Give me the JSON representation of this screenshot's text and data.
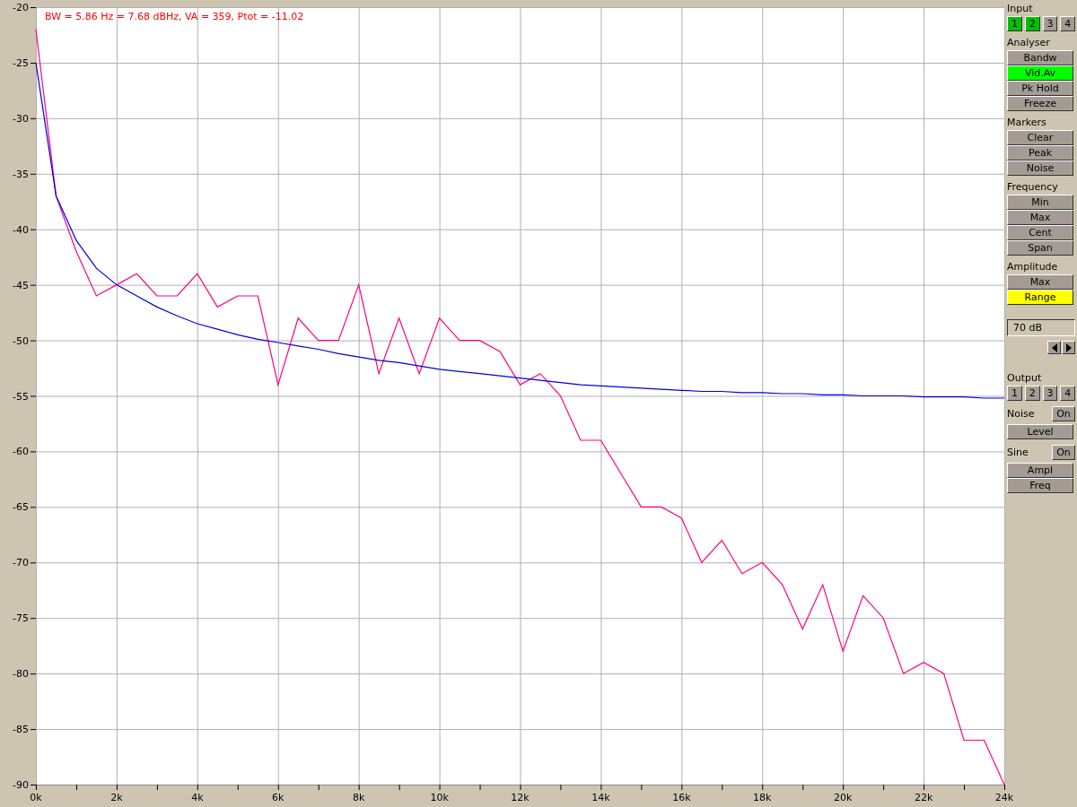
{
  "plot": {
    "readout": "BW = 5.86 Hz =  7.68 dBHz, VA = 359, Ptot = -11.02",
    "chart_data": {
      "type": "line",
      "grid": true,
      "xlim": [
        0,
        24000
      ],
      "ylim": [
        -90,
        -20
      ],
      "x": [
        0,
        500,
        1000,
        1500,
        2000,
        2500,
        3000,
        3500,
        4000,
        4500,
        5000,
        5500,
        6000,
        6500,
        7000,
        7500,
        8000,
        8500,
        9000,
        9500,
        10000,
        10500,
        11000,
        11500,
        12000,
        12500,
        13000,
        13500,
        14000,
        14500,
        15000,
        15500,
        16000,
        16500,
        17000,
        17500,
        18000,
        18500,
        19000,
        19500,
        20000,
        20500,
        21000,
        21500,
        22000,
        22500,
        23000,
        23500,
        24000
      ],
      "xticks": [
        {
          "value": 0,
          "label": "0k"
        },
        {
          "value": 2000,
          "label": "2k"
        },
        {
          "value": 4000,
          "label": "4k"
        },
        {
          "value": 6000,
          "label": "6k"
        },
        {
          "value": 8000,
          "label": "8k"
        },
        {
          "value": 10000,
          "label": "10k"
        },
        {
          "value": 12000,
          "label": "12k"
        },
        {
          "value": 14000,
          "label": "14k"
        },
        {
          "value": 16000,
          "label": "16k"
        },
        {
          "value": 18000,
          "label": "18k"
        },
        {
          "value": 20000,
          "label": "20k"
        },
        {
          "value": 22000,
          "label": "22k"
        },
        {
          "value": 24000,
          "label": "24k"
        }
      ],
      "yticks": [
        -20,
        -25,
        -30,
        -35,
        -40,
        -45,
        -50,
        -55,
        -60,
        -65,
        -70,
        -75,
        -80,
        -85,
        -90
      ],
      "series": [
        {
          "color": "#ff0080",
          "values": [
            -22,
            -37,
            -42,
            -46,
            -45,
            -44,
            -46,
            -46,
            -44,
            -47,
            -46,
            -46,
            -54,
            -48,
            -50,
            -50,
            -45,
            -53,
            -48,
            -53,
            -48,
            -50,
            -50,
            -51,
            -54,
            -53,
            -55,
            -59,
            -59,
            -62,
            -65,
            -65,
            -66,
            -70,
            -68,
            -71,
            -70,
            -72,
            -76,
            -72,
            -78,
            -73,
            -75,
            -80,
            -79,
            -80,
            -86,
            -86,
            -90
          ]
        },
        {
          "color": "#0000e0",
          "values": [
            -25,
            -37,
            -41,
            -43.5,
            -45,
            -46,
            -47,
            -47.8,
            -48.5,
            -49,
            -49.5,
            -49.9,
            -50.2,
            -50.5,
            -50.8,
            -51.2,
            -51.5,
            -51.8,
            -52,
            -52.3,
            -52.6,
            -52.8,
            -53,
            -53.2,
            -53.4,
            -53.6,
            -53.8,
            -54,
            -54.1,
            -54.2,
            -54.3,
            -54.4,
            -54.5,
            -54.6,
            -54.6,
            -54.7,
            -54.7,
            -54.8,
            -54.8,
            -54.9,
            -54.9,
            -55,
            -55,
            -55,
            -55.1,
            -55.1,
            -55.1,
            -55.2,
            -55.2
          ]
        }
      ]
    }
  },
  "panel": [
    {
      "kind": "heading",
      "text": "Input"
    },
    {
      "kind": "grid",
      "buttons": [
        {
          "label": "1",
          "lit": true,
          "color": "#00c000"
        },
        {
          "label": "2",
          "lit": true,
          "color": "#00c000"
        },
        {
          "label": "3",
          "lit": false
        },
        {
          "label": "4",
          "lit": false
        }
      ]
    },
    {
      "kind": "heading",
      "text": "Analyser"
    },
    {
      "kind": "button",
      "label": "Bandw",
      "lit": false
    },
    {
      "kind": "button",
      "label": "Vid.Av",
      "lit": true,
      "color": "#00ff00"
    },
    {
      "kind": "button",
      "label": "Pk Hold",
      "lit": false
    },
    {
      "kind": "button",
      "label": "Freeze",
      "lit": false
    },
    {
      "kind": "heading",
      "text": "Markers"
    },
    {
      "kind": "button",
      "label": "Clear",
      "lit": false
    },
    {
      "kind": "button",
      "label": "Peak",
      "lit": false
    },
    {
      "kind": "button",
      "label": "Noise",
      "lit": false
    },
    {
      "kind": "heading",
      "text": "Frequency"
    },
    {
      "kind": "button",
      "label": "Min",
      "lit": false
    },
    {
      "kind": "button",
      "label": "Max",
      "lit": false
    },
    {
      "kind": "button",
      "label": "Cent",
      "lit": false
    },
    {
      "kind": "button",
      "label": "Span",
      "lit": false
    },
    {
      "kind": "heading",
      "text": "Amplitude"
    },
    {
      "kind": "button",
      "label": "Max",
      "lit": false
    },
    {
      "kind": "button",
      "label": "Range",
      "lit": true,
      "color": "#ffff00"
    },
    {
      "kind": "value",
      "text": "70 dB"
    },
    {
      "kind": "spinner"
    },
    {
      "kind": "heading",
      "text": "Output"
    },
    {
      "kind": "grid",
      "buttons": [
        {
          "label": "1",
          "lit": false
        },
        {
          "label": "2",
          "lit": false
        },
        {
          "label": "3",
          "lit": false
        },
        {
          "label": "4",
          "lit": false
        }
      ]
    },
    {
      "kind": "toggle",
      "text": "Noise",
      "label": "On",
      "lit": false
    },
    {
      "kind": "button",
      "label": "Level",
      "lit": false
    },
    {
      "kind": "toggle",
      "text": "Sine",
      "label": "On",
      "lit": false
    },
    {
      "kind": "button",
      "label": "Ampl",
      "lit": false
    },
    {
      "kind": "button",
      "label": "Freq",
      "lit": false
    }
  ]
}
